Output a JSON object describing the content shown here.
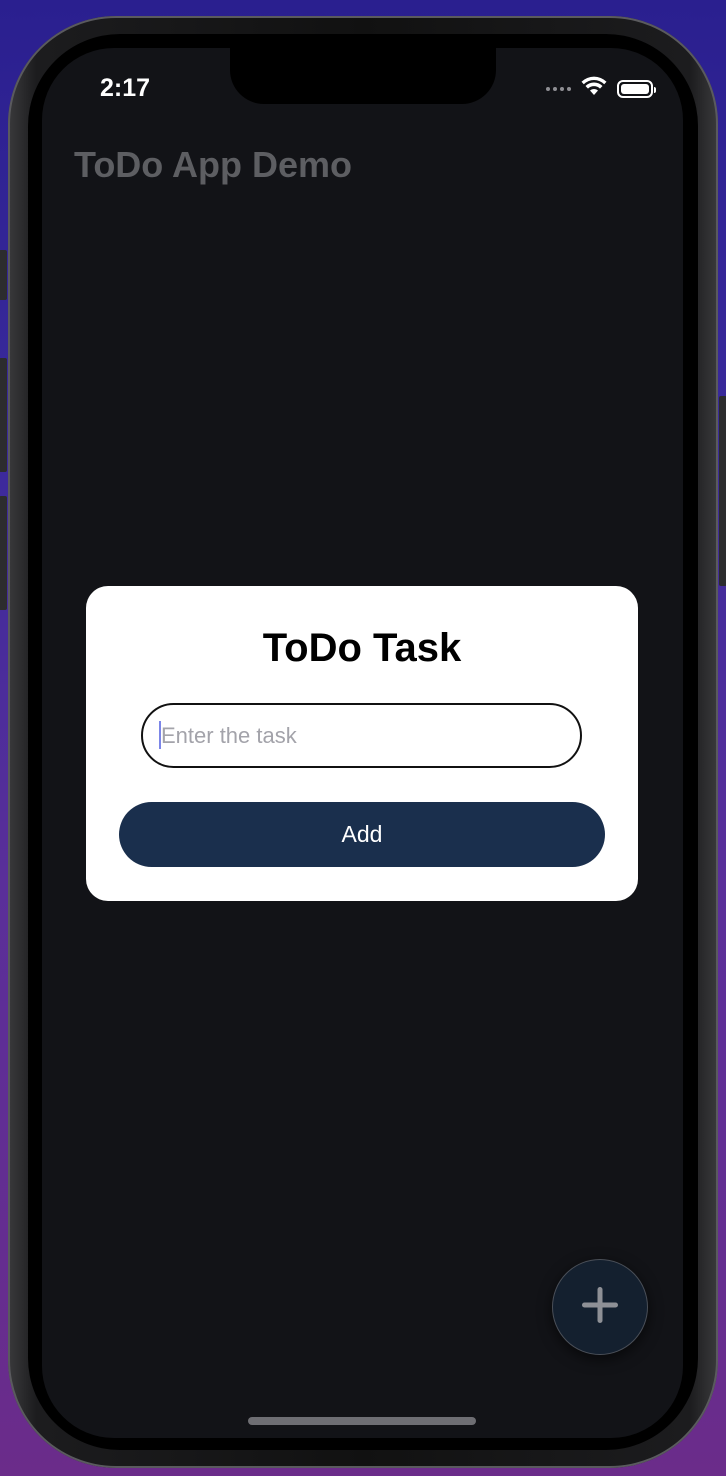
{
  "status_bar": {
    "time": "2:17",
    "signal_icon": "signal-dots-icon",
    "wifi_icon": "wifi-icon",
    "battery_icon": "battery-icon"
  },
  "app": {
    "title": "ToDo App Demo"
  },
  "dialog": {
    "title": "ToDo Task",
    "input_placeholder": "Enter the task",
    "input_value": "",
    "add_label": "Add"
  },
  "fab": {
    "icon": "plus-icon"
  },
  "colors": {
    "background": "#121317",
    "dialog_bg": "#ffffff",
    "button_bg": "#1a2f4d",
    "title_muted": "#5d5e62"
  }
}
